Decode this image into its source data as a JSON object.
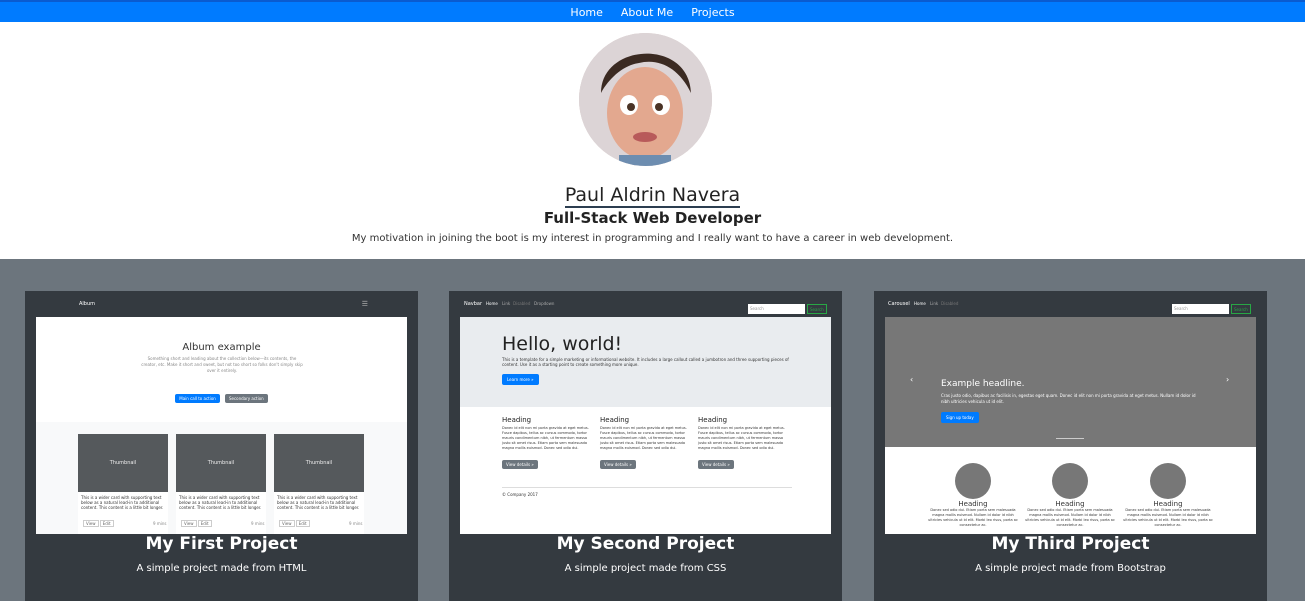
{
  "nav": {
    "items": [
      "Home",
      "About Me",
      "Projects"
    ]
  },
  "profile": {
    "name": "Paul Aldrin Navera",
    "role": "Full-Stack Web Developer",
    "motto": "My motivation in joining the boot is my interest in programming and I really want to have a career in web development."
  },
  "projects": [
    {
      "title": "My First Project",
      "text": "A simple project made from HTML",
      "preview": {
        "brand": "Album",
        "heading": "Album example",
        "lead": "Something short and leading about the collection below—its contents, the creator, etc. Make it short and sweet, but not too short so folks don't simply skip over it entirely.",
        "btn_primary": "Main call to action",
        "btn_secondary": "Secondary action",
        "thumb_label": "Thumbnail",
        "thumb_text": "This is a wider card with supporting text below as a natural lead-in to additional content. This content is a little bit longer.",
        "view": "View",
        "edit": "Edit",
        "mins": "9 mins"
      }
    },
    {
      "title": "My Second Project",
      "text": "A simple project made from CSS",
      "preview": {
        "brand": "Navbar",
        "links": [
          "Home",
          "Link",
          "Disabled",
          "Dropdown"
        ],
        "search": "Search",
        "search_btn": "Search",
        "heading": "Hello, world!",
        "lead": "This is a template for a simple marketing or informational website. It includes a large callout called a jumbotron and three supporting pieces of content. Use it as a starting point to create something more unique.",
        "learn": "Learn more »",
        "col_heading": "Heading",
        "col_text": "Donec id elit non mi porta gravida at eget metus. Fusce dapibus, tellus ac cursus commodo, tortor mauris condimentum nibh, ut fermentum massa justo sit amet risus. Etiam porta sem malesuada magna mollis euismod. Donec sed odio dui.",
        "details": "View details »",
        "footer": "© Company 2017"
      }
    },
    {
      "title": "My Third Project",
      "text": "A simple project made from Bootstrap",
      "preview": {
        "brand": "Carousel",
        "links": [
          "Home",
          "Link",
          "Disabled"
        ],
        "search": "Search",
        "search_btn": "Search",
        "headline": "Example headline.",
        "caption": "Cras justo odio, dapibus ac facilisis in, egestas eget quam. Donec id elit non mi porta gravida at eget metus. Nullam id dolor id nibh ultricies vehicula ut id elit.",
        "signup": "Sign up today",
        "col_heading": "Heading",
        "col_text": "Donec sed odio dui. Etiam porta sem malesuada magna mollis euismod. Nullam id dolor id nibh ultricies vehicula ut id elit. Morbi leo risus, porta ac consectetur ac."
      }
    }
  ],
  "colors": {
    "navbar": "#007bff",
    "section_bg": "#6c757d",
    "card_bg": "#343a40"
  }
}
